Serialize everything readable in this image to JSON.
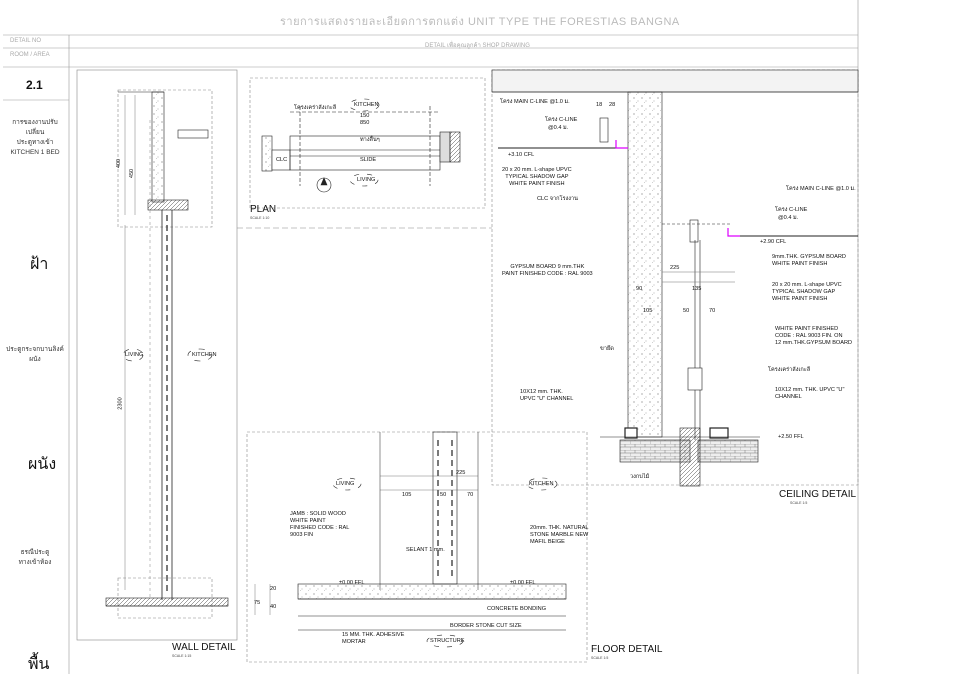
{
  "header": {
    "project_title": "รายการแสดงรายละเอียดการตกแต่ง UNIT TYPE THE FORESTIAS BANGNA",
    "sheet_title": "DETAIL เพื่อคุณลูกค้า SHOP DRAWING"
  },
  "sidebar": {
    "field_label_1": "DETAIL NO",
    "field_label_2": "ROOM / AREA",
    "detail_no": "2.1",
    "location": [
      "การของงานปรับเปลี่ยน",
      "ประตูทางเข้า",
      "KITCHEN 1 BED"
    ],
    "ceiling": "ฝ้า",
    "wall_note": "ประตูกระจกบานลิงค์ผนัง",
    "wall": "ผนัง",
    "floor_note": [
      "ธรณีประตู",
      "ทางเข้าห้อง"
    ],
    "floor": "พื้น"
  },
  "titles": {
    "plan": "PLAN",
    "plan_scale": "SCALE 1:10",
    "wall_detail": "WALL DETAIL",
    "wall_scale": "SCALE 1:15",
    "floor_detail": "FLOOR DETAIL",
    "floor_scale": "SCALE 1:5",
    "ceiling_detail": "CEILING DETAIL",
    "ceiling_scale": "SCALE 1:5"
  },
  "plan": {
    "frame_note": "โครงเคร่าลังเกะลี",
    "kitchen": "KITCHEN",
    "living": "LIVING",
    "clc": "CLC",
    "dim_150": "150",
    "dim_850": "850",
    "door_note": "ทางลื่นๆ",
    "slide": "SLIDE",
    "section_mark": "A"
  },
  "wall": {
    "living": "LIVING",
    "kitchen": "KITCHEN",
    "dim_2300": "2300",
    "dim_400": "400",
    "dim_450": "450"
  },
  "ceiling": {
    "n1": "โครง MAIN C-LINE @1.0 ม.",
    "n2": "โครง C-LINE",
    "n2b": "@0.4 ม.",
    "cfl1": "+3.10 CFL",
    "n3": [
      "20 x 20 mm. L-shape UPVC",
      "TYPICAL SHADOW GAP",
      "WHITE PAINT FINISH"
    ],
    "n4": "CLC จากโรงงาน",
    "n5": [
      "GYPSUM  BOARD 9 mm.THK",
      "PAINT FINISHED CODE : RAL 9003"
    ],
    "n6": "ขายึด",
    "n7": [
      "10X12 mm. THK.",
      "UPVC \"U\" CHANNEL"
    ],
    "n8": "วงกบไม้",
    "n9": "โครง MAIN C-LINE @1.0 ม.",
    "n10": "โครง C-LINE",
    "n10b": "@0.4 ม.",
    "cfl2": "+2.90 CFL",
    "n11": [
      "9mm.THK. GYPSUM BOARD",
      "WHITE PAINT FINISH"
    ],
    "n12": [
      "20 x 20 mm. L-shape UPVC",
      "TYPICAL SHADOW GAP",
      "WHITE PAINT FINISH"
    ],
    "n13": [
      "WHITE PAINT FINISHED",
      "CODE : RAL 9003 FIN. ON",
      "12 mm.THK.GYPSUM BOARD"
    ],
    "n14": "โครงเคร่าลังเกะลี",
    "n15": [
      "10X12 mm. THK. UPVC \"U\"",
      "CHANNEL"
    ],
    "ffl": "+2.50 FFL",
    "d225": "225",
    "d90": "90",
    "d135": "135",
    "d105": "105",
    "d50": "50",
    "d70": "70",
    "d18": "18",
    "d28": "28"
  },
  "floor": {
    "living": "LIVING",
    "kitchen": "KITCHEN",
    "jamb": [
      "JAMB : SOLID WOOD",
      "WHITE PAINT",
      "FINISHED CODE : RAL",
      "9003 FIN"
    ],
    "stone": [
      "20mm. THK. NATURAL",
      "STONE MARBLE NEW",
      "MAFIL BEIGE"
    ],
    "sealant": "SELANT 1 mm.",
    "ffl_left": "±0.00 FFL",
    "ffl_right": "±0.00 FFL",
    "bonding": "CONCRETE BONDING",
    "border": "BORDER STONE CUT SIZE",
    "adhesive": [
      "15 MM. THK. ADHESIVE",
      "MORTAR"
    ],
    "structure": "STRUCTURE",
    "d225": "225",
    "d105": "105",
    "d50": "50",
    "d70": "70",
    "d20": "20",
    "d40": "40",
    "d75": "75"
  }
}
